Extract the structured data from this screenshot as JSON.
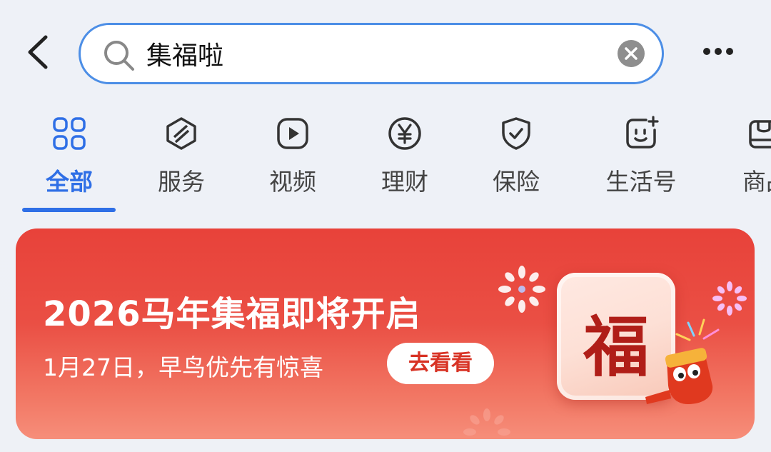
{
  "header": {
    "back_icon": "chevron-left-icon",
    "search_value": "集福啦",
    "search_icon": "search-icon",
    "clear_icon": "clear-icon",
    "more_icon": "more-icon"
  },
  "tabs": [
    {
      "label": "全部",
      "icon": "grid-icon",
      "active": true
    },
    {
      "label": "服务",
      "icon": "service-icon",
      "active": false
    },
    {
      "label": "视频",
      "icon": "video-icon",
      "active": false
    },
    {
      "label": "理财",
      "icon": "yen-icon",
      "active": false
    },
    {
      "label": "保险",
      "icon": "shield-icon",
      "active": false
    },
    {
      "label": "生活号",
      "icon": "life-account-icon",
      "active": false
    },
    {
      "label": "商品",
      "icon": "shop-icon",
      "active": false
    }
  ],
  "banner": {
    "title": "2026马年集福即将开启",
    "subtitle": "1月27日，早鸟优先有惊喜",
    "cta": "去看看",
    "card_char": "福"
  },
  "colors": {
    "accent": "#2f6fe6",
    "banner_red": "#e8423a",
    "cta_text": "#d83325"
  }
}
